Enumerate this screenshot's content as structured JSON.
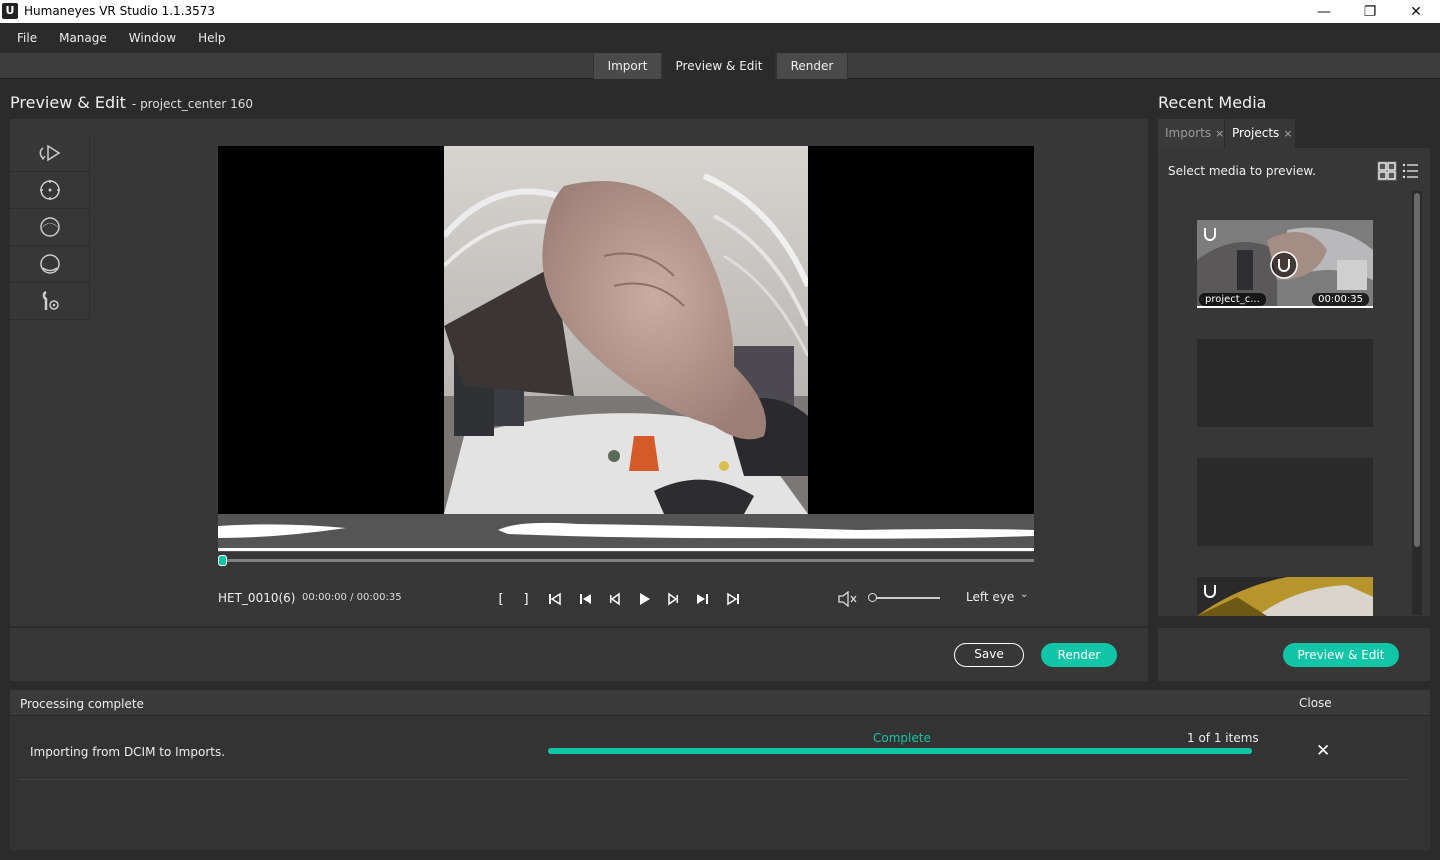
{
  "window": {
    "title": "Humaneyes VR Studio 1.1.3573",
    "app_icon": "U",
    "minimize": "—",
    "restore": "❐",
    "close": "✕"
  },
  "menu": [
    "File",
    "Manage",
    "Window",
    "Help"
  ],
  "mode_tabs": [
    {
      "label": "Import",
      "active": false
    },
    {
      "label": "Preview & Edit",
      "active": true
    },
    {
      "label": "Render",
      "active": false
    }
  ],
  "page": {
    "title": "Preview & Edit",
    "subtitle": "- project_center 160"
  },
  "tools": [
    "rotate-tool-icon",
    "crosshair-icon",
    "horizon-top-icon",
    "horizon-bottom-icon",
    "wrench-settings-icon"
  ],
  "player": {
    "clip_name": "HET_0010(6)",
    "timecode": "00:00:00 / 00:00:35",
    "playhead_fraction": 0,
    "mark_in": "[",
    "mark_out": "]",
    "volume_fraction": 0,
    "eye_select": "Left eye"
  },
  "actions": {
    "save": "Save",
    "render": "Render"
  },
  "recent_media": {
    "title": "Recent Media",
    "tabs": [
      {
        "label": "Imports",
        "active": false
      },
      {
        "label": "Projects",
        "active": true
      }
    ],
    "tab_close": "×",
    "hint": "Select media to preview.",
    "items": [
      {
        "name": "project_c...",
        "duration": "00:00:35"
      },
      {
        "name": "",
        "duration": ""
      },
      {
        "name": "",
        "duration": ""
      },
      {
        "name": "",
        "duration": ""
      }
    ],
    "action": "Preview & Edit"
  },
  "processing": {
    "title": "Processing complete",
    "close": "Close",
    "message": "Importing from DCIM to Imports.",
    "status": "Complete",
    "count": "1 of 1 items",
    "progress": 1.0,
    "dismiss": "✕"
  },
  "colors": {
    "accent": "#11c6a6",
    "background": "#2b2b2b",
    "panel": "#373737"
  }
}
